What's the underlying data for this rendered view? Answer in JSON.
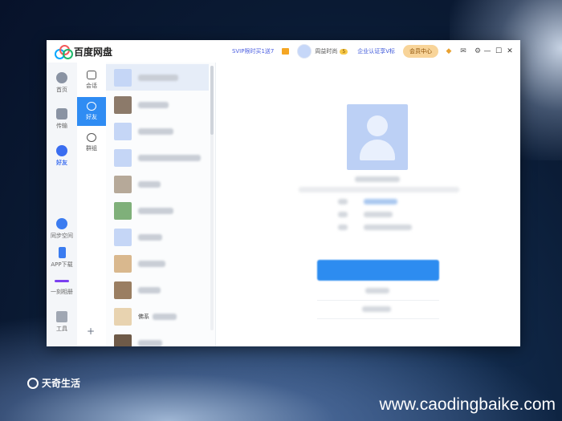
{
  "titlebar": {
    "app_title": "百度网盘",
    "svip_promo": "SVIP限时买1送7",
    "username": "周益时尚",
    "level": "5",
    "enterprise": "企业认证享V标",
    "member_center": "会员中心",
    "icons": [
      "gift-icon",
      "gamepad-icon",
      "mail-icon",
      "settings-icon",
      "minimize-icon",
      "maximize-icon",
      "close-icon"
    ]
  },
  "rail": {
    "items": [
      {
        "label": "首页",
        "icon": "cloud-icon"
      },
      {
        "label": "传输",
        "icon": "transfer-icon"
      },
      {
        "label": "好友",
        "icon": "friends-icon",
        "active": true
      },
      {
        "label": "同步空间",
        "icon": "sync-icon"
      },
      {
        "label": "APP下载",
        "icon": "phone-icon"
      },
      {
        "label": "一刻相册",
        "icon": "album-icon"
      },
      {
        "label": "工具",
        "icon": "grid-icon"
      }
    ]
  },
  "subnav": {
    "items": [
      {
        "label": "会话",
        "icon": "chat-icon"
      },
      {
        "label": "好友",
        "icon": "person-icon",
        "active": true
      },
      {
        "label": "群组",
        "icon": "group-icon"
      }
    ],
    "add_symbol": "+"
  },
  "friend_list": {
    "visible_name": "佛系"
  },
  "watermark": {
    "left": "天奇生活",
    "right": "www.caodingbaike.com"
  },
  "colors": {
    "accent": "#2f8cf3",
    "member_gold": "#f8d499"
  }
}
